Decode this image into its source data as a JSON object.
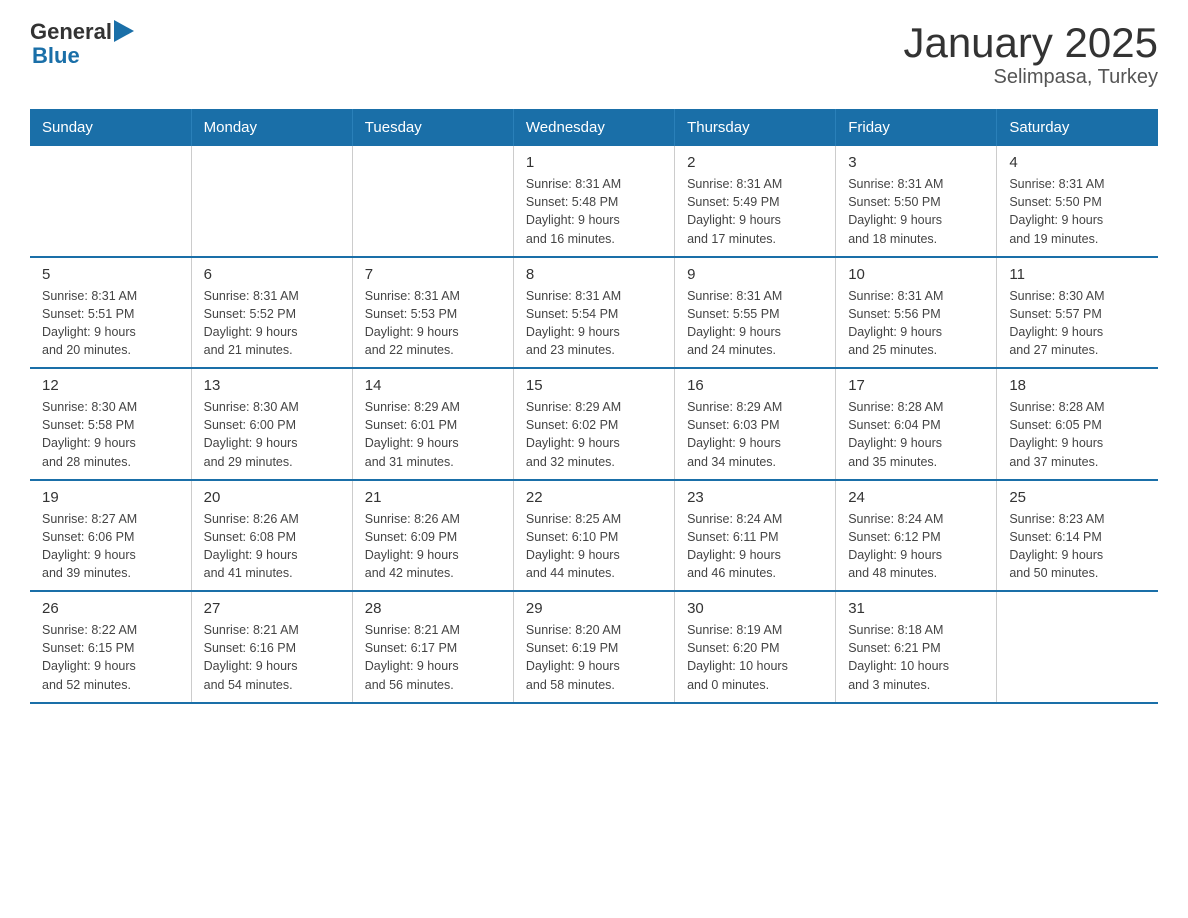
{
  "logo": {
    "general": "General",
    "blue": "Blue",
    "arrow": "▶"
  },
  "title": "January 2025",
  "subtitle": "Selimpasa, Turkey",
  "days_of_week": [
    "Sunday",
    "Monday",
    "Tuesday",
    "Wednesday",
    "Thursday",
    "Friday",
    "Saturday"
  ],
  "weeks": [
    [
      {
        "day": "",
        "info": ""
      },
      {
        "day": "",
        "info": ""
      },
      {
        "day": "",
        "info": ""
      },
      {
        "day": "1",
        "info": "Sunrise: 8:31 AM\nSunset: 5:48 PM\nDaylight: 9 hours\nand 16 minutes."
      },
      {
        "day": "2",
        "info": "Sunrise: 8:31 AM\nSunset: 5:49 PM\nDaylight: 9 hours\nand 17 minutes."
      },
      {
        "day": "3",
        "info": "Sunrise: 8:31 AM\nSunset: 5:50 PM\nDaylight: 9 hours\nand 18 minutes."
      },
      {
        "day": "4",
        "info": "Sunrise: 8:31 AM\nSunset: 5:50 PM\nDaylight: 9 hours\nand 19 minutes."
      }
    ],
    [
      {
        "day": "5",
        "info": "Sunrise: 8:31 AM\nSunset: 5:51 PM\nDaylight: 9 hours\nand 20 minutes."
      },
      {
        "day": "6",
        "info": "Sunrise: 8:31 AM\nSunset: 5:52 PM\nDaylight: 9 hours\nand 21 minutes."
      },
      {
        "day": "7",
        "info": "Sunrise: 8:31 AM\nSunset: 5:53 PM\nDaylight: 9 hours\nand 22 minutes."
      },
      {
        "day": "8",
        "info": "Sunrise: 8:31 AM\nSunset: 5:54 PM\nDaylight: 9 hours\nand 23 minutes."
      },
      {
        "day": "9",
        "info": "Sunrise: 8:31 AM\nSunset: 5:55 PM\nDaylight: 9 hours\nand 24 minutes."
      },
      {
        "day": "10",
        "info": "Sunrise: 8:31 AM\nSunset: 5:56 PM\nDaylight: 9 hours\nand 25 minutes."
      },
      {
        "day": "11",
        "info": "Sunrise: 8:30 AM\nSunset: 5:57 PM\nDaylight: 9 hours\nand 27 minutes."
      }
    ],
    [
      {
        "day": "12",
        "info": "Sunrise: 8:30 AM\nSunset: 5:58 PM\nDaylight: 9 hours\nand 28 minutes."
      },
      {
        "day": "13",
        "info": "Sunrise: 8:30 AM\nSunset: 6:00 PM\nDaylight: 9 hours\nand 29 minutes."
      },
      {
        "day": "14",
        "info": "Sunrise: 8:29 AM\nSunset: 6:01 PM\nDaylight: 9 hours\nand 31 minutes."
      },
      {
        "day": "15",
        "info": "Sunrise: 8:29 AM\nSunset: 6:02 PM\nDaylight: 9 hours\nand 32 minutes."
      },
      {
        "day": "16",
        "info": "Sunrise: 8:29 AM\nSunset: 6:03 PM\nDaylight: 9 hours\nand 34 minutes."
      },
      {
        "day": "17",
        "info": "Sunrise: 8:28 AM\nSunset: 6:04 PM\nDaylight: 9 hours\nand 35 minutes."
      },
      {
        "day": "18",
        "info": "Sunrise: 8:28 AM\nSunset: 6:05 PM\nDaylight: 9 hours\nand 37 minutes."
      }
    ],
    [
      {
        "day": "19",
        "info": "Sunrise: 8:27 AM\nSunset: 6:06 PM\nDaylight: 9 hours\nand 39 minutes."
      },
      {
        "day": "20",
        "info": "Sunrise: 8:26 AM\nSunset: 6:08 PM\nDaylight: 9 hours\nand 41 minutes."
      },
      {
        "day": "21",
        "info": "Sunrise: 8:26 AM\nSunset: 6:09 PM\nDaylight: 9 hours\nand 42 minutes."
      },
      {
        "day": "22",
        "info": "Sunrise: 8:25 AM\nSunset: 6:10 PM\nDaylight: 9 hours\nand 44 minutes."
      },
      {
        "day": "23",
        "info": "Sunrise: 8:24 AM\nSunset: 6:11 PM\nDaylight: 9 hours\nand 46 minutes."
      },
      {
        "day": "24",
        "info": "Sunrise: 8:24 AM\nSunset: 6:12 PM\nDaylight: 9 hours\nand 48 minutes."
      },
      {
        "day": "25",
        "info": "Sunrise: 8:23 AM\nSunset: 6:14 PM\nDaylight: 9 hours\nand 50 minutes."
      }
    ],
    [
      {
        "day": "26",
        "info": "Sunrise: 8:22 AM\nSunset: 6:15 PM\nDaylight: 9 hours\nand 52 minutes."
      },
      {
        "day": "27",
        "info": "Sunrise: 8:21 AM\nSunset: 6:16 PM\nDaylight: 9 hours\nand 54 minutes."
      },
      {
        "day": "28",
        "info": "Sunrise: 8:21 AM\nSunset: 6:17 PM\nDaylight: 9 hours\nand 56 minutes."
      },
      {
        "day": "29",
        "info": "Sunrise: 8:20 AM\nSunset: 6:19 PM\nDaylight: 9 hours\nand 58 minutes."
      },
      {
        "day": "30",
        "info": "Sunrise: 8:19 AM\nSunset: 6:20 PM\nDaylight: 10 hours\nand 0 minutes."
      },
      {
        "day": "31",
        "info": "Sunrise: 8:18 AM\nSunset: 6:21 PM\nDaylight: 10 hours\nand 3 minutes."
      },
      {
        "day": "",
        "info": ""
      }
    ]
  ]
}
